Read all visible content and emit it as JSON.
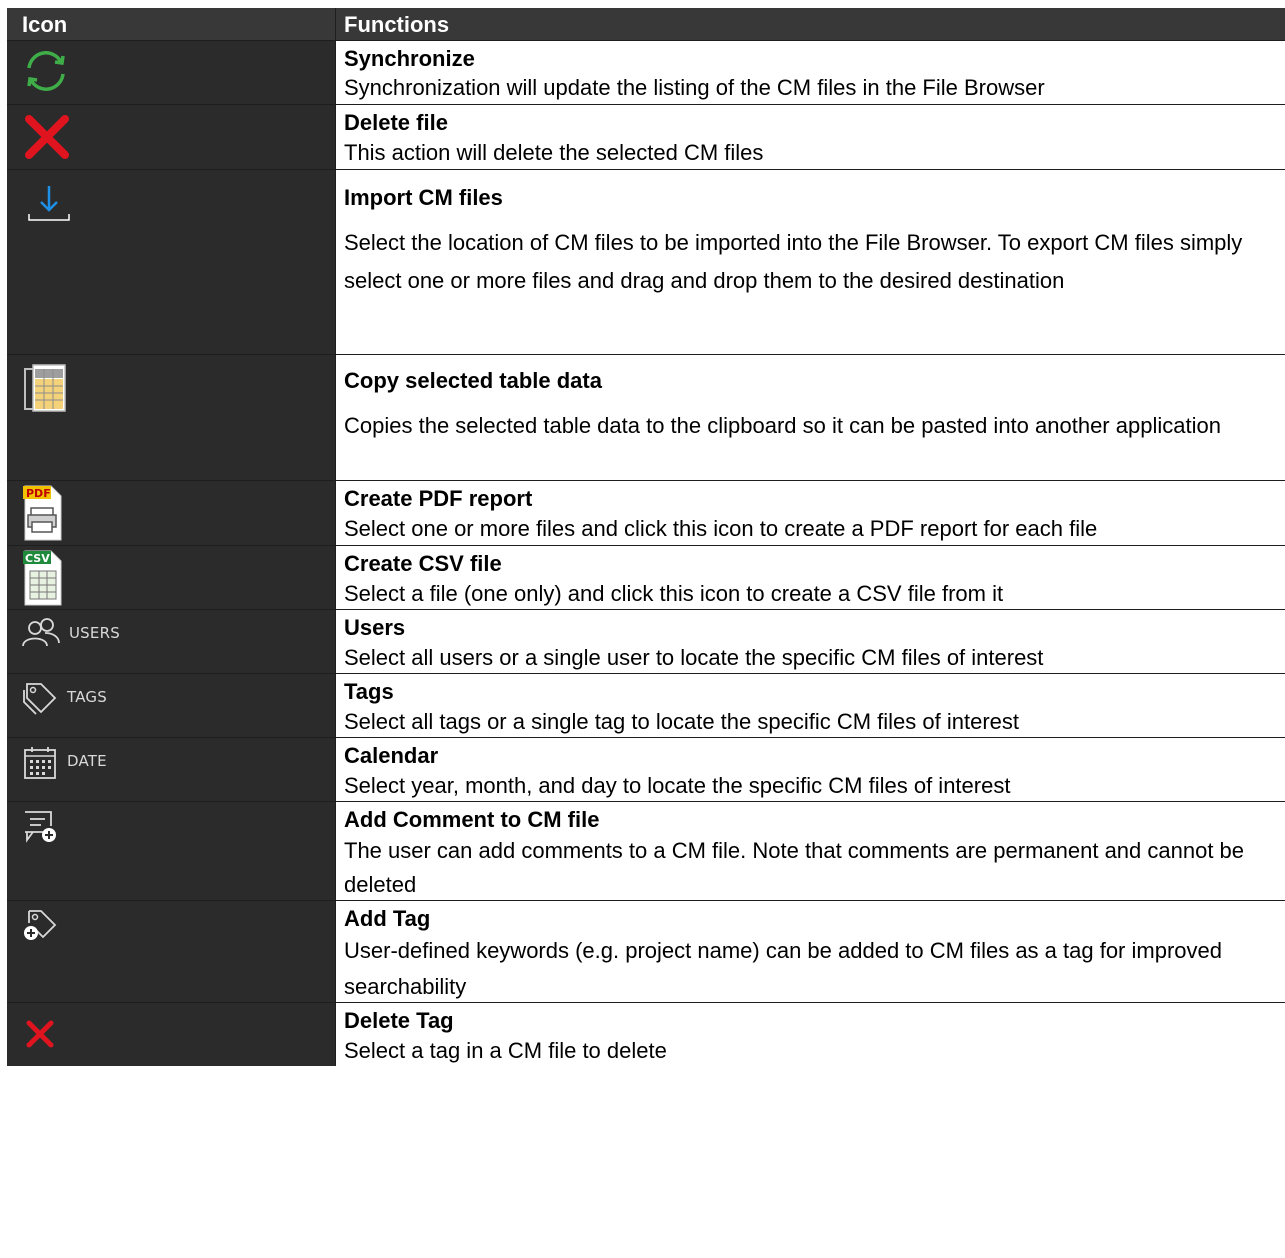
{
  "header": {
    "icon_col": "Icon",
    "functions_col": "Functions"
  },
  "rows": [
    {
      "icon": "synchronize-icon",
      "title": "Synchronize",
      "desc": "Synchronization will update the listing of the CM files in the File Browser"
    },
    {
      "icon": "delete-file-icon",
      "title": "Delete file",
      "desc": "This action will delete the selected CM files"
    },
    {
      "icon": "import-icon",
      "title": "Import CM files",
      "desc": "Select the location of CM files to be imported into the File Browser. To export CM files simply select one or more files and drag and drop them to the desired destination"
    },
    {
      "icon": "copy-table-icon",
      "title": "Copy selected table data",
      "desc": "Copies the selected table data to the clipboard so it can be pasted into another application"
    },
    {
      "icon": "pdf-report-icon",
      "icon_text": "PDF",
      "title": "Create PDF report",
      "desc": "Select one or more files and click this icon to create a PDF report for each file"
    },
    {
      "icon": "csv-file-icon",
      "icon_text": "CSV",
      "title": "Create CSV file",
      "desc": "Select a file (one only) and click this icon to create a CSV file from it"
    },
    {
      "icon": "users-icon",
      "icon_label": "USERS",
      "title": "Users",
      "desc": "Select all users or a single user to locate the specific CM files of interest"
    },
    {
      "icon": "tags-icon",
      "icon_label": "TAGS",
      "title": "Tags",
      "desc": "Select all tags or a single tag to locate the specific CM files of interest"
    },
    {
      "icon": "calendar-icon",
      "icon_label": "DATE",
      "title": "Calendar",
      "desc": "Select year, month, and day to locate the specific CM files of interest"
    },
    {
      "icon": "add-comment-icon",
      "title": "Add Comment to CM file",
      "desc": "The user can add comments to a CM file. Note that comments are permanent and cannot be deleted"
    },
    {
      "icon": "add-tag-icon",
      "title": "Add Tag",
      "desc": "User-defined keywords (e.g. project name) can be added to CM files as a tag for improved searchability"
    },
    {
      "icon": "delete-tag-icon",
      "title": "Delete Tag",
      "desc": "Select a tag in a CM file to delete"
    }
  ],
  "colors": {
    "icon_bg": "#2b2b2b",
    "header_bg": "#383838",
    "sync_green": "#3fae49",
    "delete_red": "#e0141e",
    "import_blue": "#1e90e6"
  }
}
